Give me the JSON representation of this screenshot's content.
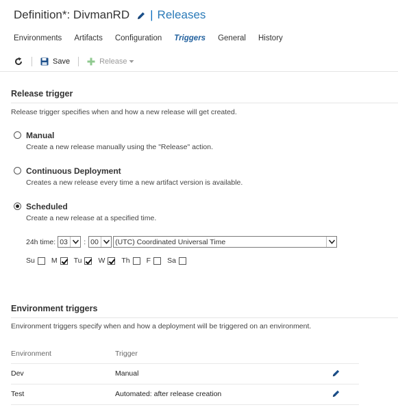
{
  "header": {
    "definition_title": "Definition*: DivmanRD",
    "separator": "|",
    "breadcrumb": "Releases"
  },
  "tabs": [
    {
      "label": "Environments"
    },
    {
      "label": "Artifacts"
    },
    {
      "label": "Configuration"
    },
    {
      "label": "Triggers",
      "active": true
    },
    {
      "label": "General"
    },
    {
      "label": "History"
    }
  ],
  "toolbar": {
    "save_label": "Save",
    "release_label": "Release"
  },
  "release_trigger": {
    "heading": "Release trigger",
    "description": "Release trigger specifies when and how a new release will get created.",
    "options": [
      {
        "label": "Manual",
        "description": "Create a new release manually using the \"Release\" action.",
        "selected": false
      },
      {
        "label": "Continuous Deployment",
        "description": "Creates a new release every time a new artifact version is available.",
        "selected": false
      },
      {
        "label": "Scheduled",
        "description": "Create a new release at a specified time.",
        "selected": true
      }
    ],
    "schedule": {
      "time_label": "24h time:",
      "hour": "03",
      "colon": ":",
      "minute": "00",
      "timezone": "(UTC) Coordinated Universal Time",
      "days": [
        {
          "label": "Su",
          "checked": false
        },
        {
          "label": "M",
          "checked": true
        },
        {
          "label": "Tu",
          "checked": true
        },
        {
          "label": "W",
          "checked": true
        },
        {
          "label": "Th",
          "checked": false
        },
        {
          "label": "F",
          "checked": false
        },
        {
          "label": "Sa",
          "checked": false
        }
      ]
    }
  },
  "environment_triggers": {
    "heading": "Environment triggers",
    "description": "Environment triggers specify when and how a deployment will be triggered on an environment.",
    "columns": [
      "Environment",
      "Trigger"
    ],
    "rows": [
      {
        "environment": "Dev",
        "trigger": "Manual"
      },
      {
        "environment": "Test",
        "trigger": "Automated: after release creation"
      }
    ]
  },
  "colors": {
    "accent": "#1f5f9d",
    "link": "#2a7ab8",
    "save_icon": "#1c4f8a",
    "release_icon_disabled": "#8fc98f"
  },
  "icons": {
    "title_edit": "pencil-icon",
    "refresh": "refresh-icon",
    "save": "floppy-disk-icon",
    "release": "plus-icon",
    "release_menu": "chevron-down-icon",
    "row_edit": "pencil-icon"
  }
}
